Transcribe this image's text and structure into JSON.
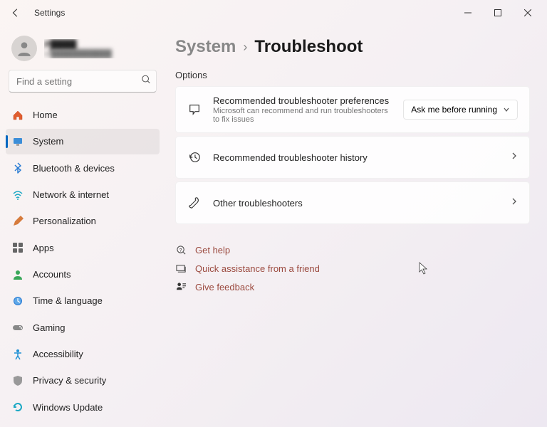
{
  "app": {
    "title": "Settings"
  },
  "profile": {
    "name": "P████",
    "email": "sr███████████"
  },
  "search": {
    "placeholder": "Find a setting"
  },
  "nav": [
    {
      "id": "home",
      "label": "Home"
    },
    {
      "id": "system",
      "label": "System",
      "active": true
    },
    {
      "id": "bluetooth",
      "label": "Bluetooth & devices"
    },
    {
      "id": "network",
      "label": "Network & internet"
    },
    {
      "id": "personalization",
      "label": "Personalization"
    },
    {
      "id": "apps",
      "label": "Apps"
    },
    {
      "id": "accounts",
      "label": "Accounts"
    },
    {
      "id": "time",
      "label": "Time & language"
    },
    {
      "id": "gaming",
      "label": "Gaming"
    },
    {
      "id": "accessibility",
      "label": "Accessibility"
    },
    {
      "id": "privacy",
      "label": "Privacy & security"
    },
    {
      "id": "update",
      "label": "Windows Update"
    }
  ],
  "breadcrumb": {
    "parent": "System",
    "sep": "›",
    "current": "Troubleshoot"
  },
  "section_label": "Options",
  "options": {
    "prefs": {
      "title": "Recommended troubleshooter preferences",
      "sub": "Microsoft can recommend and run troubleshooters to fix issues",
      "dropdown": "Ask me before running"
    },
    "history": {
      "title": "Recommended troubleshooter history"
    },
    "other": {
      "title": "Other troubleshooters"
    }
  },
  "links": {
    "help": "Get help",
    "assist": "Quick assistance from a friend",
    "feedback": "Give feedback"
  }
}
